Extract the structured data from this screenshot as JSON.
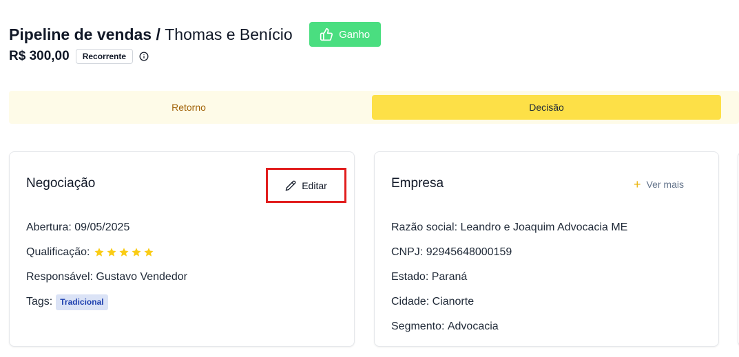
{
  "header": {
    "pipeline": "Pipeline de vendas /",
    "deal_name": "Thomas e Benício",
    "won_label": "Ganho",
    "amount": "R$ 300,00",
    "recurrence": "Recorrente"
  },
  "stages": [
    {
      "label": "Retorno",
      "active": false
    },
    {
      "label": "Decisão",
      "active": true
    }
  ],
  "negotiation": {
    "title": "Negociação",
    "edit_label": "Editar",
    "opening_label": "Abertura:",
    "opening_value": "09/05/2025",
    "qualification_label": "Qualificação:",
    "qualification_stars": 5,
    "owner_label": "Responsável:",
    "owner_value": "Gustavo Vendedor",
    "tags_label": "Tags:",
    "tag": "Tradicional"
  },
  "company": {
    "title": "Empresa",
    "more_label": "Ver mais",
    "legal_name_label": "Razão social:",
    "legal_name_value": "Leandro e Joaquim Advocacia ME",
    "cnpj_label": "CNPJ:",
    "cnpj_value": "92945648000159",
    "state_label": "Estado:",
    "state_value": "Paraná",
    "city_label": "Cidade:",
    "city_value": "Cianorte",
    "segment_label": "Segmento:",
    "segment_value": "Advocacia"
  },
  "colors": {
    "won": "#4ade80",
    "stage_active": "#fde047",
    "stage_bg": "#fefbe8",
    "highlight": "#e11d1d",
    "star": "#facc15"
  }
}
